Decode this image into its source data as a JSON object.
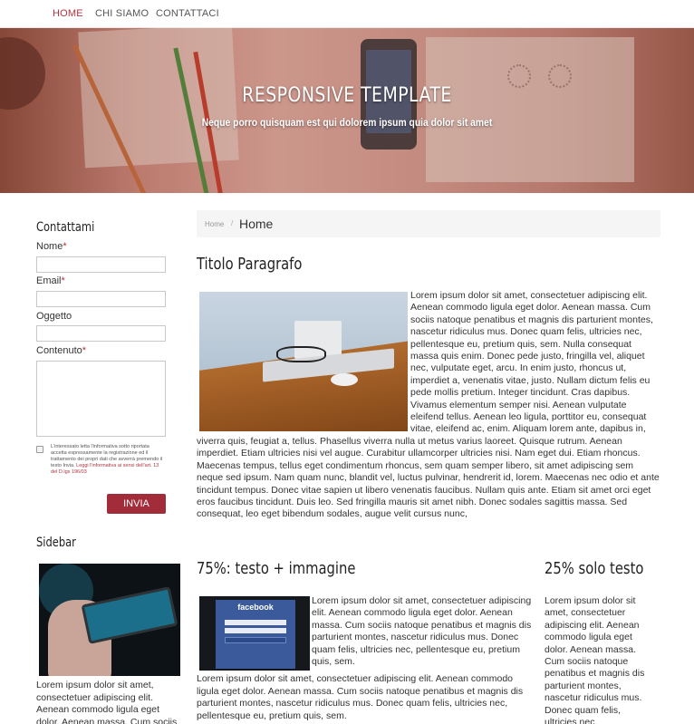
{
  "nav": {
    "items": [
      {
        "label": "HOME",
        "active": true
      },
      {
        "label": "CHI SIAMO",
        "active": false
      },
      {
        "label": "CONTATTACI",
        "active": false
      }
    ]
  },
  "hero": {
    "title": "RESPONSIVE TEMPLATE",
    "subtitle": "Neque porro quisquam est qui dolorem ipsum quia dolor sit amet"
  },
  "contact_form": {
    "title": "Contattami",
    "name_label": "Nome",
    "email_label": "Email",
    "subject_label": "Oggetto",
    "content_label": "Contenuto",
    "required_mark": "*",
    "privacy_text": "L'interessato letta l'informativa sotto riportata accetta espressamente la registrazione ed il trattamento dei propri dati che avverrà premendo il testo Invia.",
    "privacy_link": "Leggi l'informativa ai sensi dell'art. 13 del D.lgs 196/03",
    "submit_label": "INVIA"
  },
  "sidebar": {
    "title": "Sidebar",
    "text": "Lorem ipsum dolor sit amet, consectetuer adipiscing elit. Aenean commodo ligula eget dolor. Aenean massa. Cum sociis"
  },
  "breadcrumb": {
    "home": "Home",
    "separator": "/",
    "current": "Home"
  },
  "main": {
    "title": "Titolo Paragrafo",
    "text": "Lorem ipsum dolor sit amet, consectetuer adipiscing elit. Aenean commodo ligula eget dolor. Aenean massa. Cum sociis natoque penatibus et magnis dis parturient montes, nascetur ridiculus mus. Donec quam felis, ultricies nec, pellentesque eu, pretium quis, sem. Nulla consequat massa quis enim. Donec pede justo, fringilla vel, aliquet nec, vulputate eget, arcu. In enim justo, rhoncus ut, imperdiet a, venenatis vitae, justo. Nullam dictum felis eu pede mollis pretium. Integer tincidunt. Cras dapibus. Vivamus elementum semper nisi. Aenean vulputate eleifend tellus. Aenean leo ligula, porttitor eu, consequat vitae, eleifend ac, enim. Aliquam lorem ante, dapibus in, viverra quis, feugiat a, tellus. Phasellus viverra nulla ut metus varius laoreet. Quisque rutrum. Aenean imperdiet. Etiam ultricies nisi vel augue. Curabitur ullamcorper ultricies nisi. Nam eget dui. Etiam rhoncus. Maecenas tempus, tellus eget condimentum rhoncus, sem quam semper libero, sit amet adipiscing sem neque sed ipsum. Nam quam nunc, blandit vel, luctus pulvinar, hendrerit id, lorem. Maecenas nec odio et ante tincidunt tempus. Donec vitae sapien ut libero venenatis faucibus. Nullam quis ante. Etiam sit amet orci eget eros faucibus tincidunt. Duis leo. Sed fringilla mauris sit amet nibh. Donec sodales sagittis massa. Sed consequat, leo eget bibendum sodales, augue velit cursus nunc,"
  },
  "col75": {
    "title": "75%: testo + immagine",
    "image_label": "facebook",
    "text1": "Lorem ipsum dolor sit amet, consectetuer adipiscing elit. Aenean commodo ligula eget dolor. Aenean massa. Cum sociis natoque penatibus et magnis dis parturient montes, nascetur ridiculus mus. Donec quam felis, ultricies nec, pellentesque eu, pretium quis, sem.",
    "text2": "Lorem ipsum dolor sit amet, consectetuer adipiscing elit. Aenean commodo ligula eget dolor. Aenean massa. Cum sociis natoque penatibus et magnis dis parturient montes, nascetur ridiculus mus. Donec quam felis, ultricies nec, pellentesque eu, pretium quis, sem."
  },
  "col25": {
    "title": "25% solo testo",
    "text": "Lorem ipsum dolor sit amet, consectetuer adipiscing elit. Aenean commodo ligula eget dolor. Aenean massa. Cum sociis natoque penatibus et magnis dis parturient montes, nascetur ridiculus mus. Donec quam felis, ultricies nec,"
  },
  "colors": {
    "accent": "#b03440",
    "button": "#a32c3b"
  }
}
